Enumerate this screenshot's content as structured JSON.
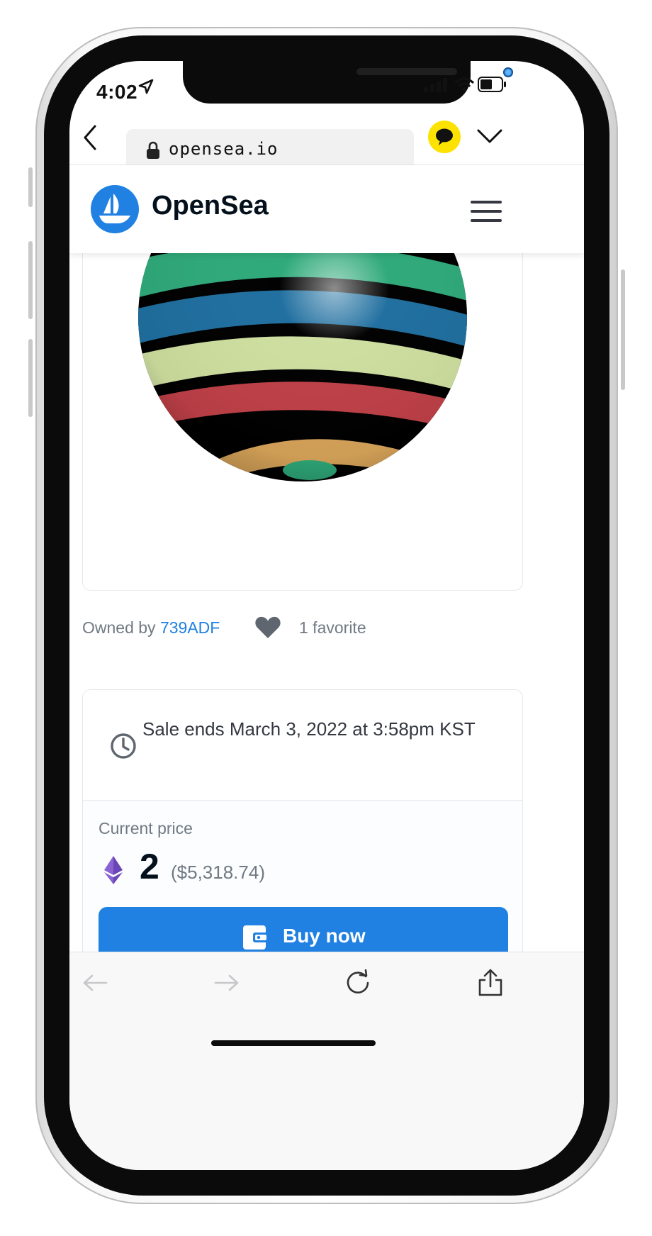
{
  "status_bar": {
    "time": "4:02",
    "icons": [
      "location-arrow-icon",
      "signal-icon",
      "wifi-icon",
      "battery-icon"
    ]
  },
  "browser": {
    "back_icon": "chevron-left-icon",
    "url": "opensea.io",
    "lock_icon": "lock-icon",
    "kakao_icon": "kakao-talk-icon",
    "menu_icon": "chevron-down-icon"
  },
  "site": {
    "brand": "OpenSea",
    "logo_icon": "opensea-ship-icon",
    "menu_icon": "hamburger-icon"
  },
  "item": {
    "owned_by_label": "Owned by",
    "owner": "739ADF",
    "favorites": "1 favorite",
    "favorite_icon": "heart-icon"
  },
  "sale": {
    "ends_text": "Sale ends March 3, 2022 at 3:58pm KST",
    "clock_icon": "clock-icon",
    "price_label": "Current price",
    "price": "2",
    "price_usd": "($5,318.74)",
    "currency_icon": "ethereum-icon",
    "buy_label": "Buy now",
    "buy_icon": "wallet-icon"
  },
  "toolbar": {
    "icons": [
      "back-arrow-icon",
      "forward-arrow-icon",
      "reload-icon",
      "share-icon"
    ]
  },
  "colors": {
    "accent": "#2081e2",
    "text_dark": "#04111d",
    "text_muted": "#707a83",
    "kakao_yellow": "#fde200"
  }
}
